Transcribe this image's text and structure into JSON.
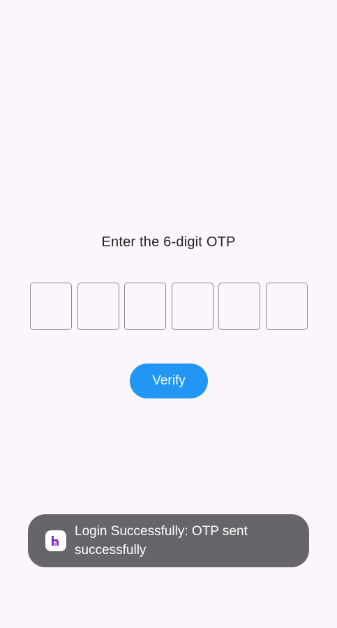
{
  "screen": {
    "background": "#fcf5fc"
  },
  "otp": {
    "prompt": "Enter the 6-digit OTP",
    "digits": [
      "",
      "",
      "",
      "",
      "",
      ""
    ]
  },
  "verify": {
    "label": "Verify",
    "color": "#2196f3"
  },
  "toast": {
    "message": "Login Successfully: OTP sent successfully",
    "icon": "app-logo-icon",
    "background": "#67656a"
  }
}
